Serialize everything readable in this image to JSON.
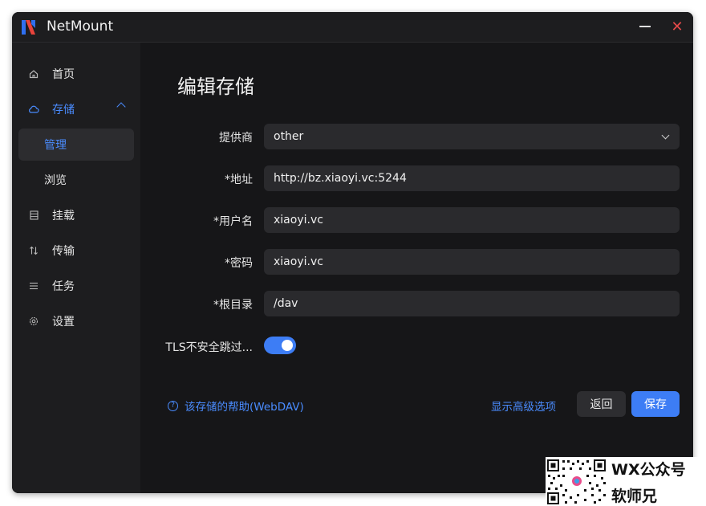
{
  "app": {
    "title": "NetMount"
  },
  "colors": {
    "accent": "#3d7df5",
    "link": "#4a8cff",
    "close": "#e64a4a"
  },
  "sidebar": {
    "items": [
      {
        "label": "首页",
        "icon": "home-icon"
      },
      {
        "label": "存储",
        "icon": "cloud-icon",
        "expanded": true
      },
      {
        "label": "管理",
        "selected": true
      },
      {
        "label": "浏览"
      },
      {
        "label": "挂载",
        "icon": "disk-icon"
      },
      {
        "label": "传输",
        "icon": "transfer-icon"
      },
      {
        "label": "任务",
        "icon": "list-icon"
      },
      {
        "label": "设置",
        "icon": "gear-icon"
      }
    ]
  },
  "main": {
    "title": "编辑存储",
    "form": {
      "provider": {
        "label": "提供商",
        "value": "other"
      },
      "address": {
        "label": "*地址",
        "value": "http://bz.xiaoyi.vc:5244"
      },
      "username": {
        "label": "*用户名",
        "value": "xiaoyi.vc"
      },
      "password": {
        "label": "*密码",
        "value": "xiaoyi.vc"
      },
      "root_dir": {
        "label": "*根目录",
        "value": "/dav"
      },
      "tls_skip": {
        "label": "TLS不安全跳过...",
        "enabled": true
      }
    },
    "help_link": "该存储的帮助(WebDAV)",
    "advanced_link": "显示高级选项",
    "back_label": "返回",
    "save_label": "保存"
  },
  "watermark": {
    "line1": "WX公众号",
    "line2": "软师兄"
  }
}
